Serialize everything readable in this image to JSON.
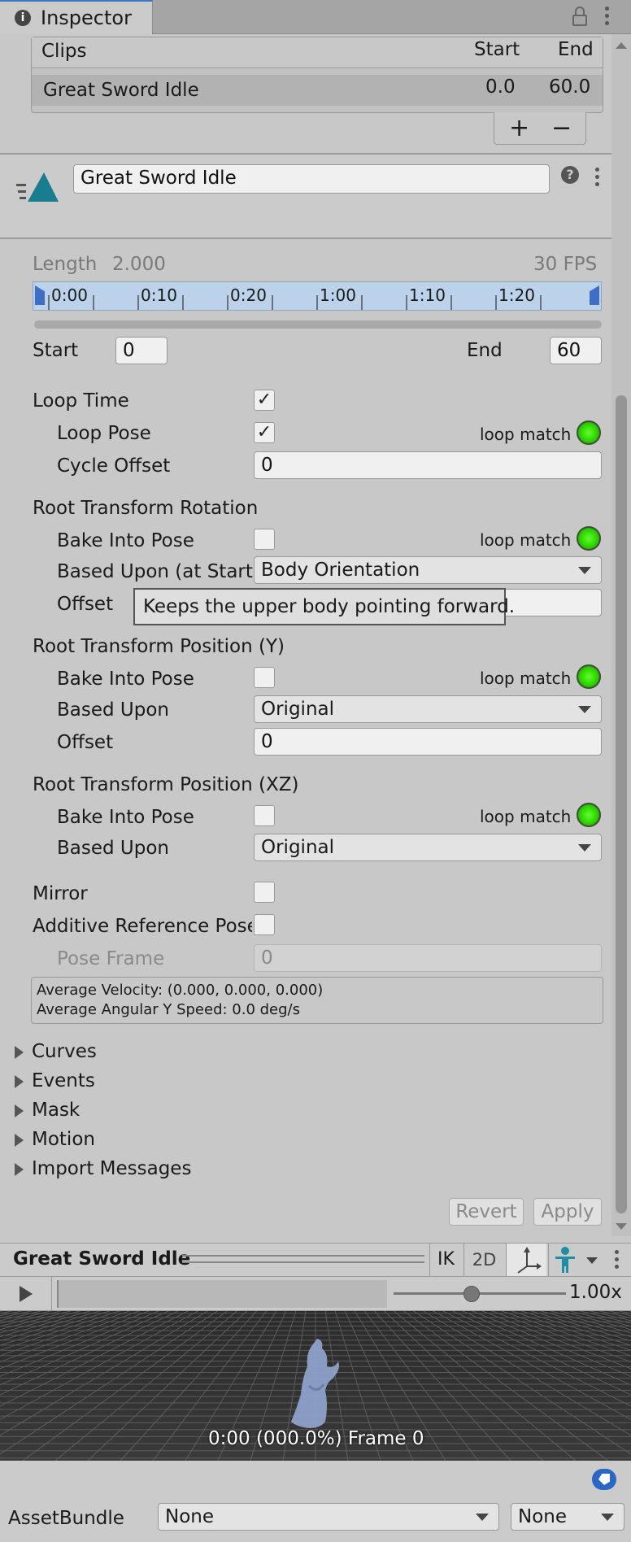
{
  "window": {
    "tab_label": "Inspector"
  },
  "clips": {
    "header_name": "Clips",
    "header_start": "Start",
    "header_end": "End",
    "rows": [
      {
        "name": "Great Sword Idle",
        "start": "0.0",
        "end": "60.0"
      }
    ],
    "add_label": "+",
    "remove_label": "−"
  },
  "clip_header": {
    "name_value": "Great Sword Idle",
    "help_glyph": "?"
  },
  "timeline": {
    "length_label": "Length",
    "length_value": "2.000",
    "fps": "30 FPS",
    "ticks": [
      "0:00",
      "0:10",
      "0:20",
      "1:00",
      "1:10",
      "1:20"
    ]
  },
  "range": {
    "start_label": "Start",
    "start_value": "0",
    "end_label": "End",
    "end_value": "60"
  },
  "loop": {
    "loop_time_label": "Loop Time",
    "loop_pose_label": "Loop Pose",
    "loop_match_label": "loop match",
    "cycle_offset_label": "Cycle Offset",
    "cycle_offset_value": "0"
  },
  "rotation": {
    "title": "Root Transform Rotation",
    "bake_label": "Bake Into Pose",
    "loop_match_label": "loop match",
    "based_upon_label": "Based Upon (at Start)",
    "based_upon_value": "Body Orientation",
    "offset_label": "Offset",
    "tooltip": "Keeps the upper body pointing forward."
  },
  "position_y": {
    "title": "Root Transform Position (Y)",
    "bake_label": "Bake Into Pose",
    "loop_match_label": "loop match",
    "based_upon_label": "Based Upon",
    "based_upon_value": "Original",
    "offset_label": "Offset",
    "offset_value": "0"
  },
  "position_xz": {
    "title": "Root Transform Position (XZ)",
    "bake_label": "Bake Into Pose",
    "loop_match_label": "loop match",
    "based_upon_label": "Based Upon",
    "based_upon_value": "Original"
  },
  "misc": {
    "mirror_label": "Mirror",
    "additive_label": "Additive Reference Pose",
    "pose_frame_label": "Pose Frame",
    "pose_frame_value": "0",
    "avg_velocity": "Average Velocity: (0.000, 0.000, 0.000)",
    "avg_angular": "Average Angular Y Speed: 0.0 deg/s"
  },
  "foldouts": [
    "Curves",
    "Events",
    "Mask",
    "Motion",
    "Import Messages"
  ],
  "actions": {
    "revert_label": "Revert",
    "apply_label": "Apply"
  },
  "preview": {
    "title": "Great Sword Idle",
    "ik_label": "IK",
    "twod_label": "2D",
    "speed_label": "1.00x",
    "speed_fraction": 0.45,
    "frame_caption": "0:00 (000.0%) Frame 0"
  },
  "asset_bundle": {
    "label": "AssetBundle",
    "name_value": "None",
    "variant_value": "None"
  }
}
